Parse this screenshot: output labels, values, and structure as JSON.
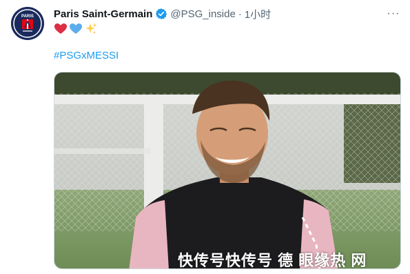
{
  "author": {
    "name": "Paris Saint-Germain",
    "handle": "@PSG_inside",
    "separator": "·",
    "time": "1小时",
    "avatar_text": "PARIS",
    "brand_color": "#1a2a5c",
    "verified_color": "#1d9bf0"
  },
  "tweet": {
    "emojis": [
      "red-heart",
      "blue-heart",
      "sparkles"
    ],
    "hashtag": "#PSGxMESSI",
    "hashtag_color": "#1d9bf0"
  },
  "media": {
    "watermark": "快传号快传号 德 眼缘热 网"
  },
  "more_menu": {
    "label": "···"
  }
}
